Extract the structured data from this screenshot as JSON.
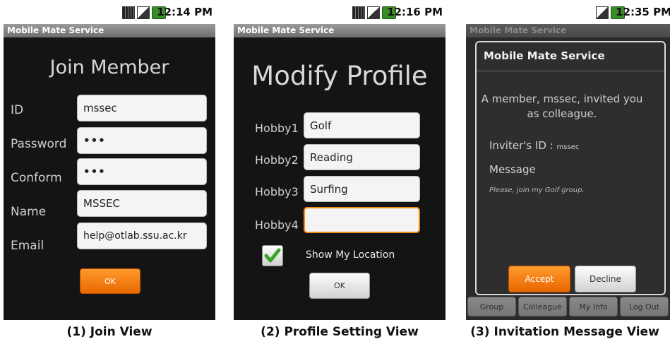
{
  "status": {
    "join_time": "12:14 PM",
    "profile_time": "12:16 PM",
    "invite_time": "12:35 PM"
  },
  "app_title": "Mobile Mate Service",
  "join": {
    "heading": "Join Member",
    "fields": [
      {
        "label": "ID",
        "value": "mssec"
      },
      {
        "label": "Password",
        "value": "•••"
      },
      {
        "label": "Conform",
        "value": "•••"
      },
      {
        "label": "Name",
        "value": "MSSEC"
      },
      {
        "label": "Email",
        "value": "help@otlab.ssu.ac.kr"
      }
    ],
    "ok_label": "OK"
  },
  "profile": {
    "heading": "Modify Profile",
    "fields": [
      {
        "label": "Hobby1",
        "value": "Golf"
      },
      {
        "label": "Hobby2",
        "value": "Reading"
      },
      {
        "label": "Hobby3",
        "value": "Surfing"
      },
      {
        "label": "Hobby4",
        "value": ""
      }
    ],
    "show_location_label": "Show My Location",
    "show_location_checked": true,
    "ok_label": "OK"
  },
  "invite": {
    "dialog_title": "Mobile Mate Service",
    "message_line1": "A member, mssec, invited you",
    "message_line2": "as colleague.",
    "inviter_label": "Inviter's ID :",
    "inviter_value": "mssec",
    "message_label": "Message",
    "message_text": "Please, join my Golf group.",
    "accept_label": "Accept",
    "decline_label": "Decline",
    "tabs": [
      "Group",
      "Colleague",
      "My Info",
      "Log Out"
    ]
  },
  "captions": {
    "join": "(1) Join View",
    "profile": "(2) Profile Setting View",
    "invite": "(3) Invitation Message View"
  },
  "colors": {
    "accent_orange": "#f07a10",
    "check_green": "#3aa52a",
    "screen_bg": "#141414"
  }
}
